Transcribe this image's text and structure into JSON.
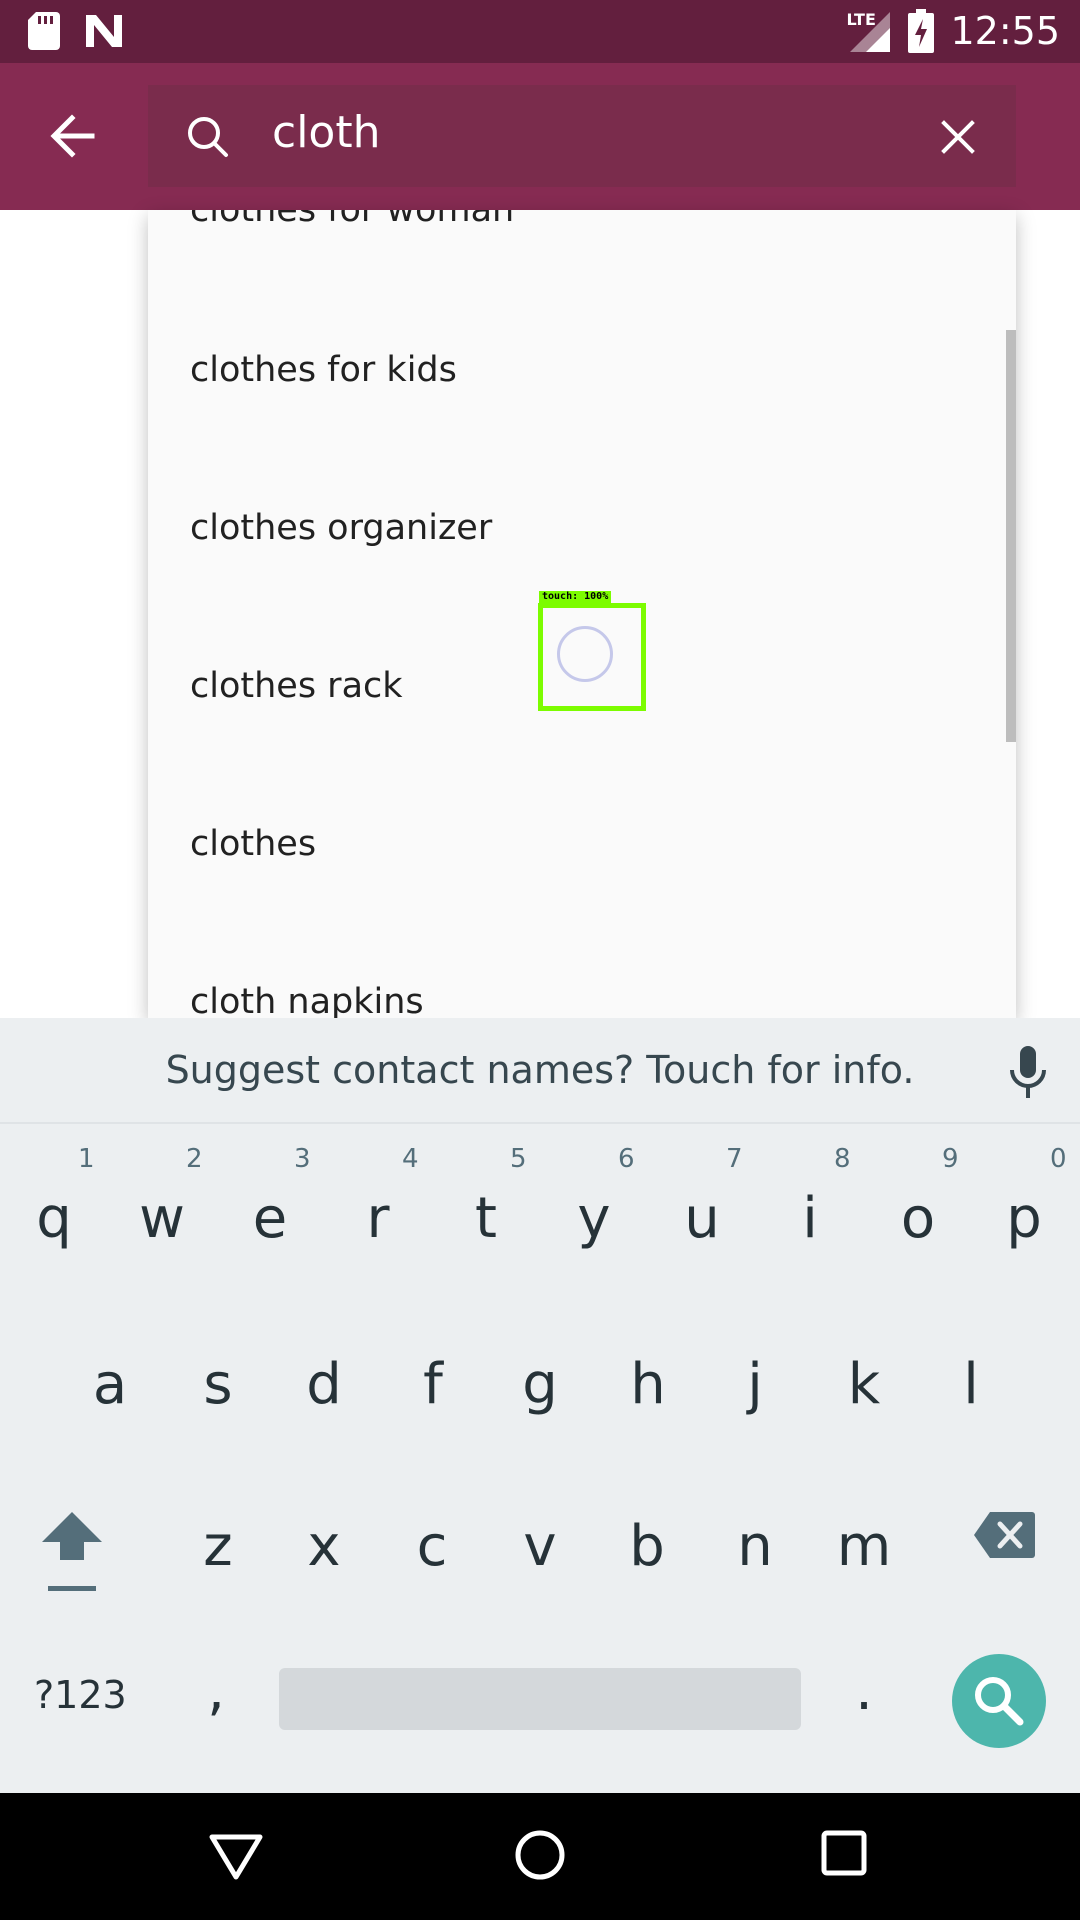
{
  "status_bar": {
    "time": "12:55",
    "network": "LTE",
    "left_icons": [
      "sd-card-icon",
      "n-logo-icon"
    ],
    "right_icons": [
      "lte-signal-icon",
      "battery-charging-icon"
    ]
  },
  "app_bar": {
    "back_icon": "arrow-left-icon",
    "search_icon": "search-icon",
    "search_value": "cloth",
    "clear_icon": "close-icon",
    "colors": {
      "bar": "#862b52",
      "status": "#631f3e"
    }
  },
  "suggestions": [
    "clothes for woman",
    "clothes for kids",
    "clothes organizer",
    "clothes rack",
    "clothes",
    "cloth napkins"
  ],
  "touch_overlay": {
    "label": "touch: 100%"
  },
  "keyboard": {
    "suggest_text": "Suggest contact names? Touch for info.",
    "row1": [
      "q",
      "w",
      "e",
      "r",
      "t",
      "y",
      "u",
      "i",
      "o",
      "p"
    ],
    "row1_numbers": [
      "1",
      "2",
      "3",
      "4",
      "5",
      "6",
      "7",
      "8",
      "9",
      "0"
    ],
    "row2": [
      "a",
      "s",
      "d",
      "f",
      "g",
      "h",
      "j",
      "k",
      "l"
    ],
    "row3": [
      "z",
      "x",
      "c",
      "v",
      "b",
      "n",
      "m"
    ],
    "symbols_key": "?123",
    "comma_key": ",",
    "period_key": ".",
    "action_color": "#4db6ac"
  },
  "nav_bar": {
    "back_icon": "triangle-back-icon",
    "home_icon": "circle-home-icon",
    "recents_icon": "square-recents-icon"
  }
}
